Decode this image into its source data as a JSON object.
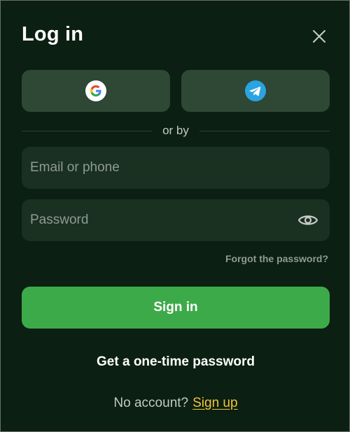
{
  "modal": {
    "title": "Log in"
  },
  "social": {
    "google_icon": "google-logo-icon",
    "telegram_icon": "telegram-logo-icon"
  },
  "divider": {
    "text": "or by"
  },
  "form": {
    "email_placeholder": "Email or phone",
    "email_value": "",
    "password_placeholder": "Password",
    "password_value": "",
    "forgot_label": "Forgot the password?",
    "signin_label": "Sign in"
  },
  "footer": {
    "otp_label": "Get a one-time password",
    "no_account_text": "No account?",
    "signup_label": "Sign up"
  },
  "colors": {
    "background": "#0b1f12",
    "social_button": "#2f4735",
    "input_bg": "#1a3020",
    "primary": "#3daa49",
    "link_accent": "#f3c43a",
    "telegram_blue": "#2aa3e0"
  }
}
